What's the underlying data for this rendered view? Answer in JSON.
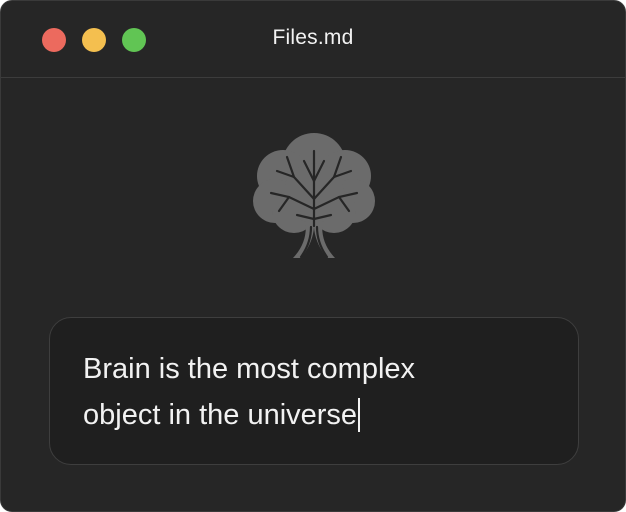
{
  "window": {
    "title": "Files.md",
    "controls": {
      "close_color": "#ec6a5e",
      "minimize_color": "#f4bf4f",
      "zoom_color": "#61c554"
    }
  },
  "main": {
    "icon": "tree-icon",
    "icon_color": "#6b6b6b",
    "editor": {
      "value": "Brain is the most complex\nobject in the universe"
    }
  }
}
